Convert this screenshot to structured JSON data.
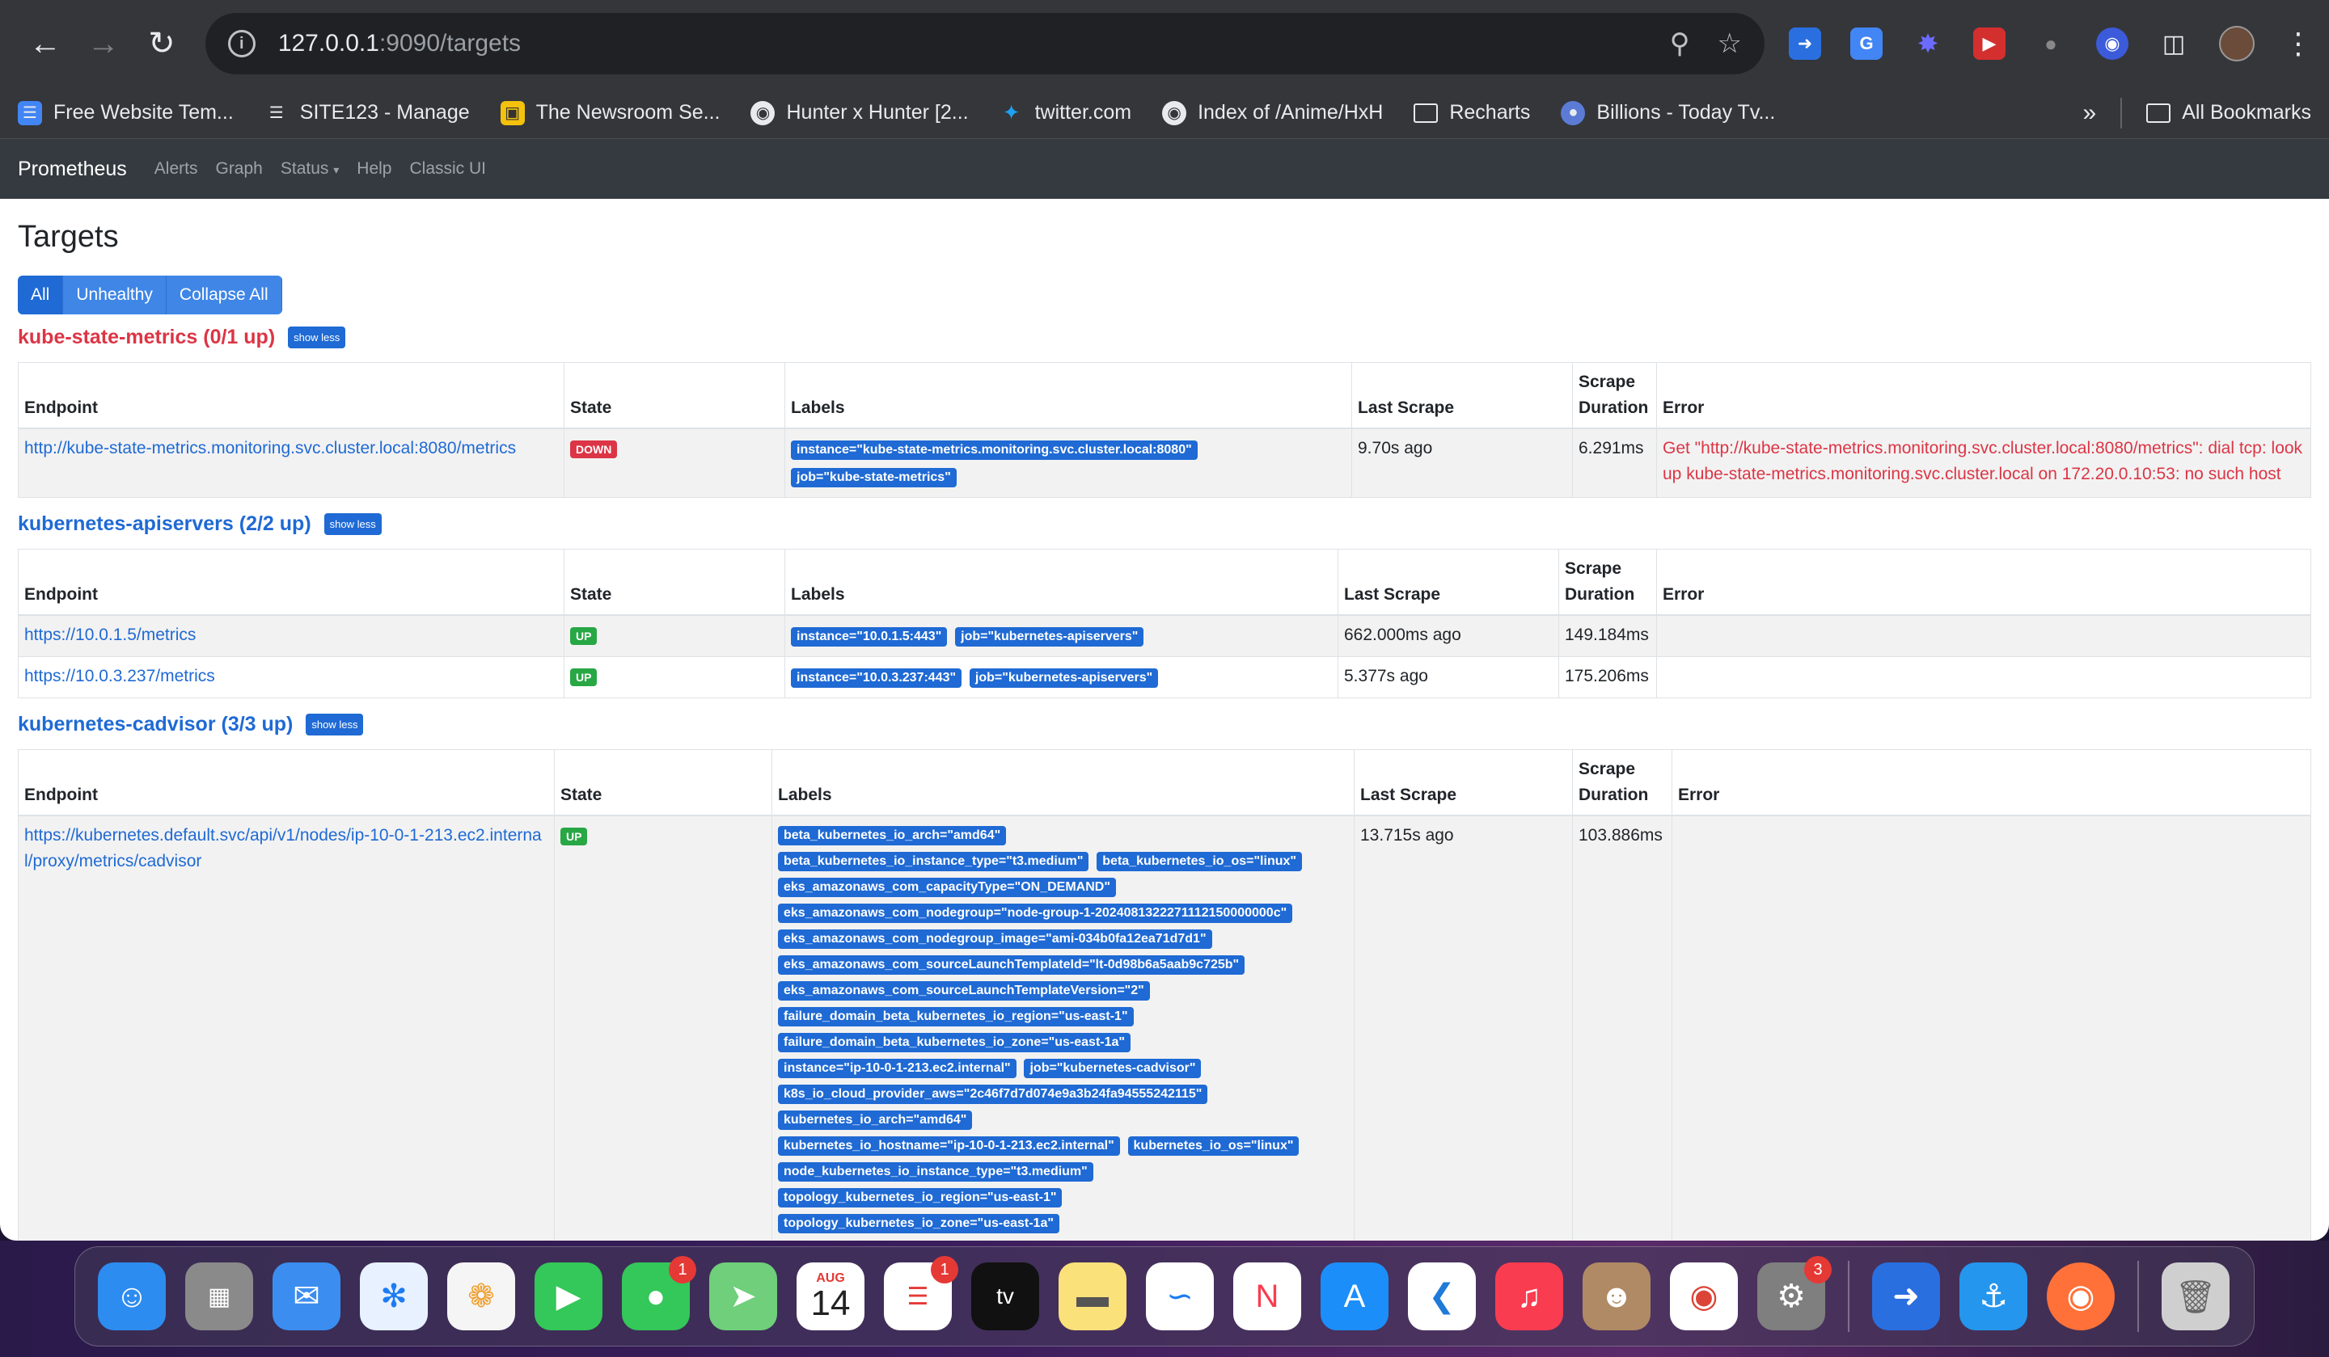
{
  "browser": {
    "url_host": "127.0.0.1",
    "url_path": ":9090/targets",
    "bookmarks": [
      {
        "label": "Free Website Tem...",
        "icon": "doc-icon",
        "color": "#4285f4"
      },
      {
        "label": "SITE123 - Manage",
        "icon": "site123-icon",
        "color": "#35363a"
      },
      {
        "label": "The Newsroom Se...",
        "icon": "newsroom-icon",
        "color": "#f4c20d"
      },
      {
        "label": "Hunter x Hunter [2...",
        "icon": "globe-icon",
        "color": "#35363a"
      },
      {
        "label": "twitter.com",
        "icon": "twitter-icon",
        "color": "#1da1f2"
      },
      {
        "label": "Index of /Anime/HxH",
        "icon": "globe-icon",
        "color": "#35363a"
      },
      {
        "label": "Recharts",
        "icon": "folder-icon",
        "color": "#35363a"
      },
      {
        "label": "Billions - Today Tv...",
        "icon": "billions-icon",
        "color": "#5b7bd5"
      }
    ],
    "all_bookmarks": "All Bookmarks"
  },
  "prometheus": {
    "brand": "Prometheus",
    "nav": [
      "Alerts",
      "Graph",
      "Status",
      "Help",
      "Classic UI"
    ],
    "page_title": "Targets",
    "filters": [
      "All",
      "Unhealthy",
      "Collapse All"
    ],
    "show_less": "show less",
    "columns": {
      "endpoint": "Endpoint",
      "state": "State",
      "labels": "Labels",
      "last_scrape": "Last Scrape",
      "scrape_duration_1": "Scrape",
      "scrape_duration_2": "Duration",
      "error": "Error"
    },
    "pools": [
      {
        "title": "kube-state-metrics (0/1 up)",
        "targets": [
          {
            "endpoint": "http://kube-state-metrics.monitoring.svc.cluster.local:8080/metrics",
            "state": "DOWN",
            "labels": [
              "instance=\"kube-state-metrics.monitoring.svc.cluster.local:8080\"",
              "job=\"kube-state-metrics\""
            ],
            "last_scrape": "9.70s ago",
            "duration": "6.291ms",
            "error": "Get \"http://kube-state-metrics.monitoring.svc.cluster.local:8080/metrics\": dial tcp: lookup kube-state-metrics.monitoring.svc.cluster.local on 172.20.0.10:53: no such host"
          }
        ]
      },
      {
        "title": "kubernetes-apiservers (2/2 up)",
        "targets": [
          {
            "endpoint": "https://10.0.1.5/metrics",
            "state": "UP",
            "labels": [
              "instance=\"10.0.1.5:443\"",
              "job=\"kubernetes-apiservers\""
            ],
            "last_scrape": "662.000ms ago",
            "duration": "149.184ms",
            "error": ""
          },
          {
            "endpoint": "https://10.0.3.237/metrics",
            "state": "UP",
            "labels": [
              "instance=\"10.0.3.237:443\"",
              "job=\"kubernetes-apiservers\""
            ],
            "last_scrape": "5.377s ago",
            "duration": "175.206ms",
            "error": ""
          }
        ]
      },
      {
        "title": "kubernetes-cadvisor (3/3 up)",
        "targets": [
          {
            "endpoint": "https://kubernetes.default.svc/api/v1/nodes/ip-10-0-1-213.ec2.internal/proxy/metrics/cadvisor",
            "state": "UP",
            "labels": [
              "beta_kubernetes_io_arch=\"amd64\"",
              "beta_kubernetes_io_instance_type=\"t3.medium\"",
              "beta_kubernetes_io_os=\"linux\"",
              "eks_amazonaws_com_capacityType=\"ON_DEMAND\"",
              "eks_amazonaws_com_nodegroup=\"node-group-1-2024081322271112150000000c\"",
              "eks_amazonaws_com_nodegroup_image=\"ami-034b0fa12ea71d7d1\"",
              "eks_amazonaws_com_sourceLaunchTemplateId=\"lt-0d98b6a5aab9c725b\"",
              "eks_amazonaws_com_sourceLaunchTemplateVersion=\"2\"",
              "failure_domain_beta_kubernetes_io_region=\"us-east-1\"",
              "failure_domain_beta_kubernetes_io_zone=\"us-east-1a\"",
              "instance=\"ip-10-0-1-213.ec2.internal\"",
              "job=\"kubernetes-cadvisor\"",
              "k8s_io_cloud_provider_aws=\"2c46f7d7d074e9a3b24fa94555242115\"",
              "kubernetes_io_arch=\"amd64\"",
              "kubernetes_io_hostname=\"ip-10-0-1-213.ec2.internal\"",
              "kubernetes_io_os=\"linux\"",
              "node_kubernetes_io_instance_type=\"t3.medium\"",
              "topology_kubernetes_io_region=\"us-east-1\"",
              "topology_kubernetes_io_zone=\"us-east-1a\""
            ],
            "last_scrape": "13.715s ago",
            "duration": "103.886ms",
            "error": ""
          }
        ]
      }
    ]
  },
  "dock": {
    "apps": [
      {
        "name": "finder",
        "color": "#2d8cf0"
      },
      {
        "name": "launchpad",
        "color": "#8a8a8a"
      },
      {
        "name": "mail",
        "color": "#3b8ef0"
      },
      {
        "name": "safari",
        "color": "#e8f1ff"
      },
      {
        "name": "photos",
        "color": "#f5f5f5"
      },
      {
        "name": "facetime",
        "color": "#34c759"
      },
      {
        "name": "messages",
        "color": "#34c759",
        "badge": "1"
      },
      {
        "name": "maps",
        "color": "#6fcf7a"
      },
      {
        "name": "calendar",
        "color": "#ffffff",
        "month": "AUG",
        "day": "14"
      },
      {
        "name": "reminders",
        "color": "#ffffff",
        "badge": "1"
      },
      {
        "name": "apple-tv",
        "color": "#111111"
      },
      {
        "name": "notes",
        "color": "#fbe17a"
      },
      {
        "name": "freeform",
        "color": "#ffffff"
      },
      {
        "name": "news",
        "color": "#ffffff"
      },
      {
        "name": "app-store",
        "color": "#1c8ef9"
      },
      {
        "name": "vscode",
        "color": "#ffffff"
      },
      {
        "name": "music",
        "color": "#fa3c50"
      },
      {
        "name": "contacts",
        "color": "#b08a64"
      },
      {
        "name": "chrome",
        "color": "#ffffff"
      },
      {
        "name": "system-settings",
        "color": "#7f7f7f",
        "badge": "3"
      },
      {
        "name": "screen-sharing",
        "color": "#2a6fe0"
      },
      {
        "name": "docker",
        "color": "#2496ed"
      },
      {
        "name": "firefox",
        "color": "#ff7139"
      },
      {
        "name": "trash",
        "color": "#cfcfcf"
      }
    ]
  }
}
